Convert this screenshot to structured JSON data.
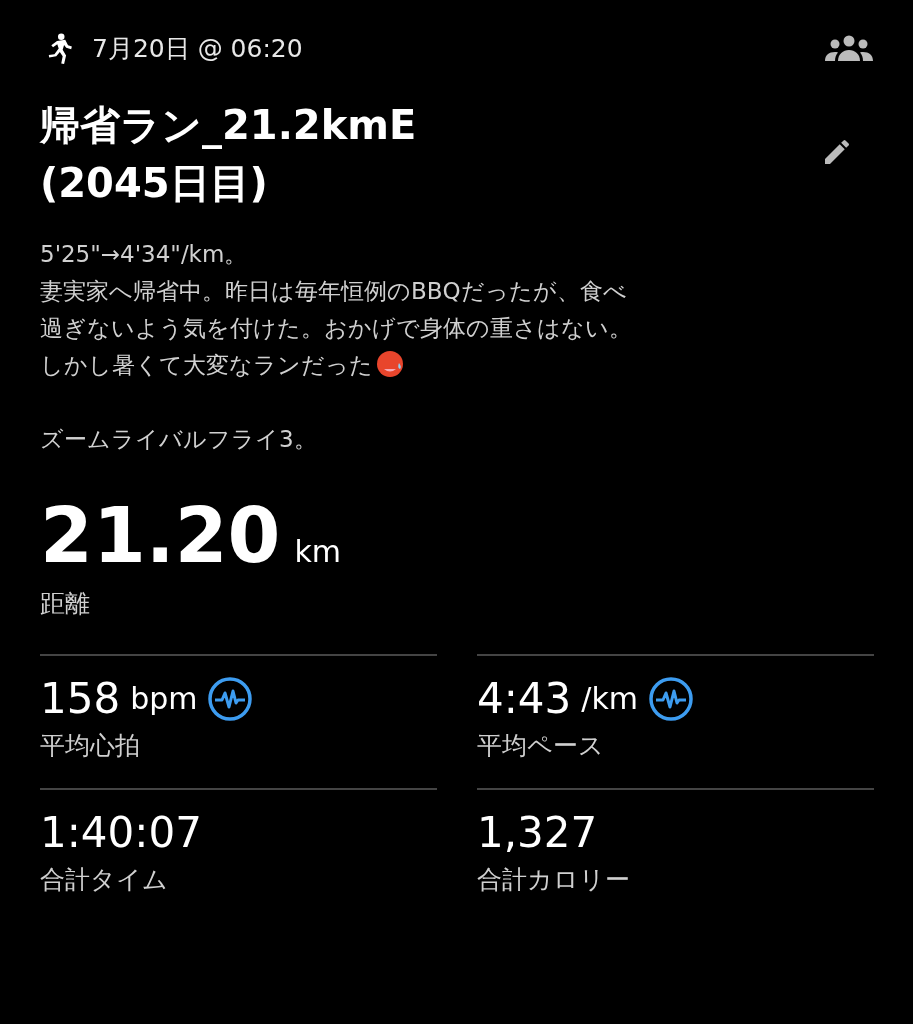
{
  "header": {
    "date": "7月20日 @ 06:20"
  },
  "title": "帰省ラン_21.2kmE\n(2045日目)",
  "description": {
    "paragraphs": [
      [
        "5'25\"→4'34\"/km。",
        "妻実家へ帰省中。昨日は毎年恒例のBBQだったが、食べ",
        "過ぎないよう気を付けた。おかげで身体の重さはない。",
        "しかし暑くて大変なランだった"
      ],
      [
        "ズームライバルフライ3。"
      ]
    ],
    "trailing_emoji": true
  },
  "distance": {
    "value": "21.20",
    "unit": "km",
    "label": "距離"
  },
  "stats": [
    {
      "value": "158",
      "unit": "bpm",
      "label": "平均心拍",
      "activity_icon": true
    },
    {
      "value": "4:43",
      "unit": "/km",
      "label": "平均ペース",
      "activity_icon": true
    },
    {
      "value": "1:40:07",
      "label": "合計タイム",
      "activity_icon": false
    },
    {
      "value": "1,327",
      "label": "合計カロリー",
      "activity_icon": false
    }
  ]
}
